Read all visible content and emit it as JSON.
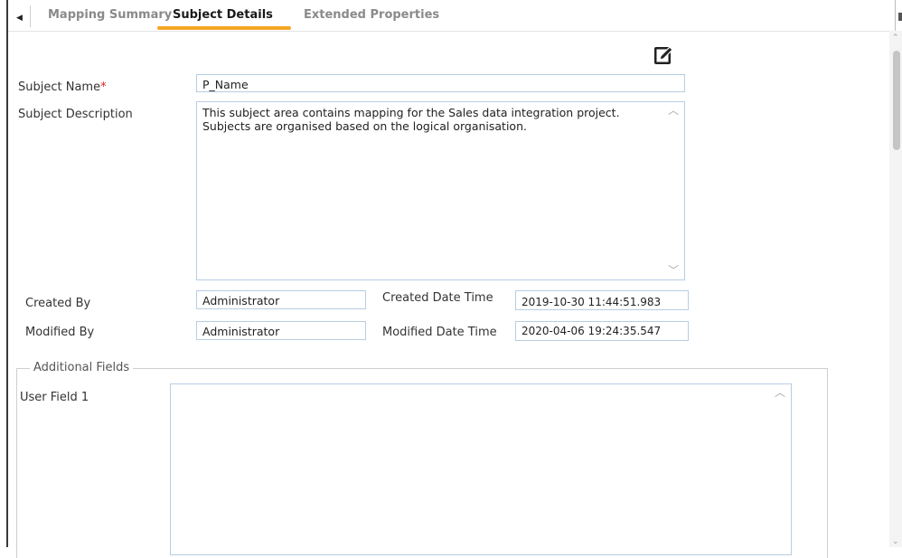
{
  "tabs": [
    {
      "label": "Mapping Summary",
      "active": false
    },
    {
      "label": "Subject Details",
      "active": true
    },
    {
      "label": "Extended Properties",
      "active": false
    }
  ],
  "form": {
    "subject_name_label": "Subject Name",
    "subject_name_required": "*",
    "subject_name_value": "P_Name",
    "subject_description_label": "Subject Description",
    "subject_description_value": "This subject area contains mapping for the Sales data integration project.\nSubjects are organised based on the logical organisation.",
    "created_by_label": "Created By",
    "created_by_value": "Administrator",
    "created_date_time_label": "Created Date Time",
    "created_date_time_value": "2019-10-30 11:44:51.983",
    "modified_by_label": "Modified By",
    "modified_by_value": "Administrator",
    "modified_date_time_label": "Modified Date Time",
    "modified_date_time_value": "2020-04-06 19:24:35.547"
  },
  "additional_fields": {
    "legend": "Additional Fields",
    "user_field_1_label": "User Field 1",
    "user_field_1_value": ""
  },
  "icons": {
    "edit": "edit-icon",
    "tab_scroll_left": "triangle-left-icon"
  },
  "colors": {
    "active_tab_underline": "#f5a623",
    "input_border": "#b8cde4",
    "required_marker": "#e02020"
  }
}
